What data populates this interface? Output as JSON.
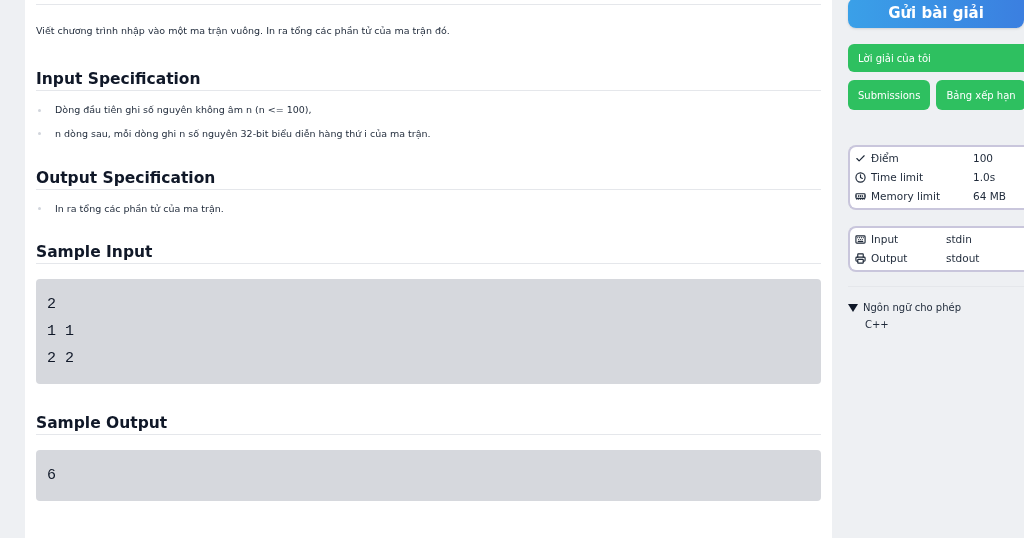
{
  "description": "Viết chương trình nhập vào một ma trận vuông. In ra tổng các phần tử của ma trận đó.",
  "sections": [
    {
      "kind": "list",
      "heading": "Input Specification",
      "items": [
        "Dòng đầu tiên ghi số nguyên không âm n (n <= 100),",
        "n dòng sau, mỗi dòng ghi n số nguyên 32-bit biểu diễn hàng thứ i của ma trận."
      ]
    },
    {
      "kind": "list",
      "heading": "Output Specification",
      "items": [
        "In ra tổng các phần tử của ma trận."
      ]
    },
    {
      "kind": "code",
      "heading": "Sample Input",
      "lines": [
        "2",
        "1 1",
        "2 2"
      ]
    },
    {
      "kind": "code",
      "heading": "Sample Output",
      "lines": [
        "6"
      ]
    }
  ],
  "sidebar": {
    "submit_button": "Gửi bài giải",
    "my_solution_button": "Lời giải của tôi",
    "buttons": [
      "Submissions",
      "Bảng xếp hạn"
    ],
    "limits": [
      {
        "kind": "points",
        "label": "Điểm",
        "value": "100"
      },
      {
        "kind": "time",
        "label": "Time limit",
        "value": "1.0s"
      },
      {
        "kind": "memory",
        "label": "Memory limit",
        "value": "64 MB"
      }
    ],
    "io": [
      {
        "kind": "input",
        "label": "Input",
        "value": "stdin"
      },
      {
        "kind": "output",
        "label": "Output",
        "value": "stdout"
      }
    ],
    "languages": {
      "label": "Ngôn ngữ cho phép",
      "expanded": true,
      "items": [
        "C++"
      ]
    }
  }
}
